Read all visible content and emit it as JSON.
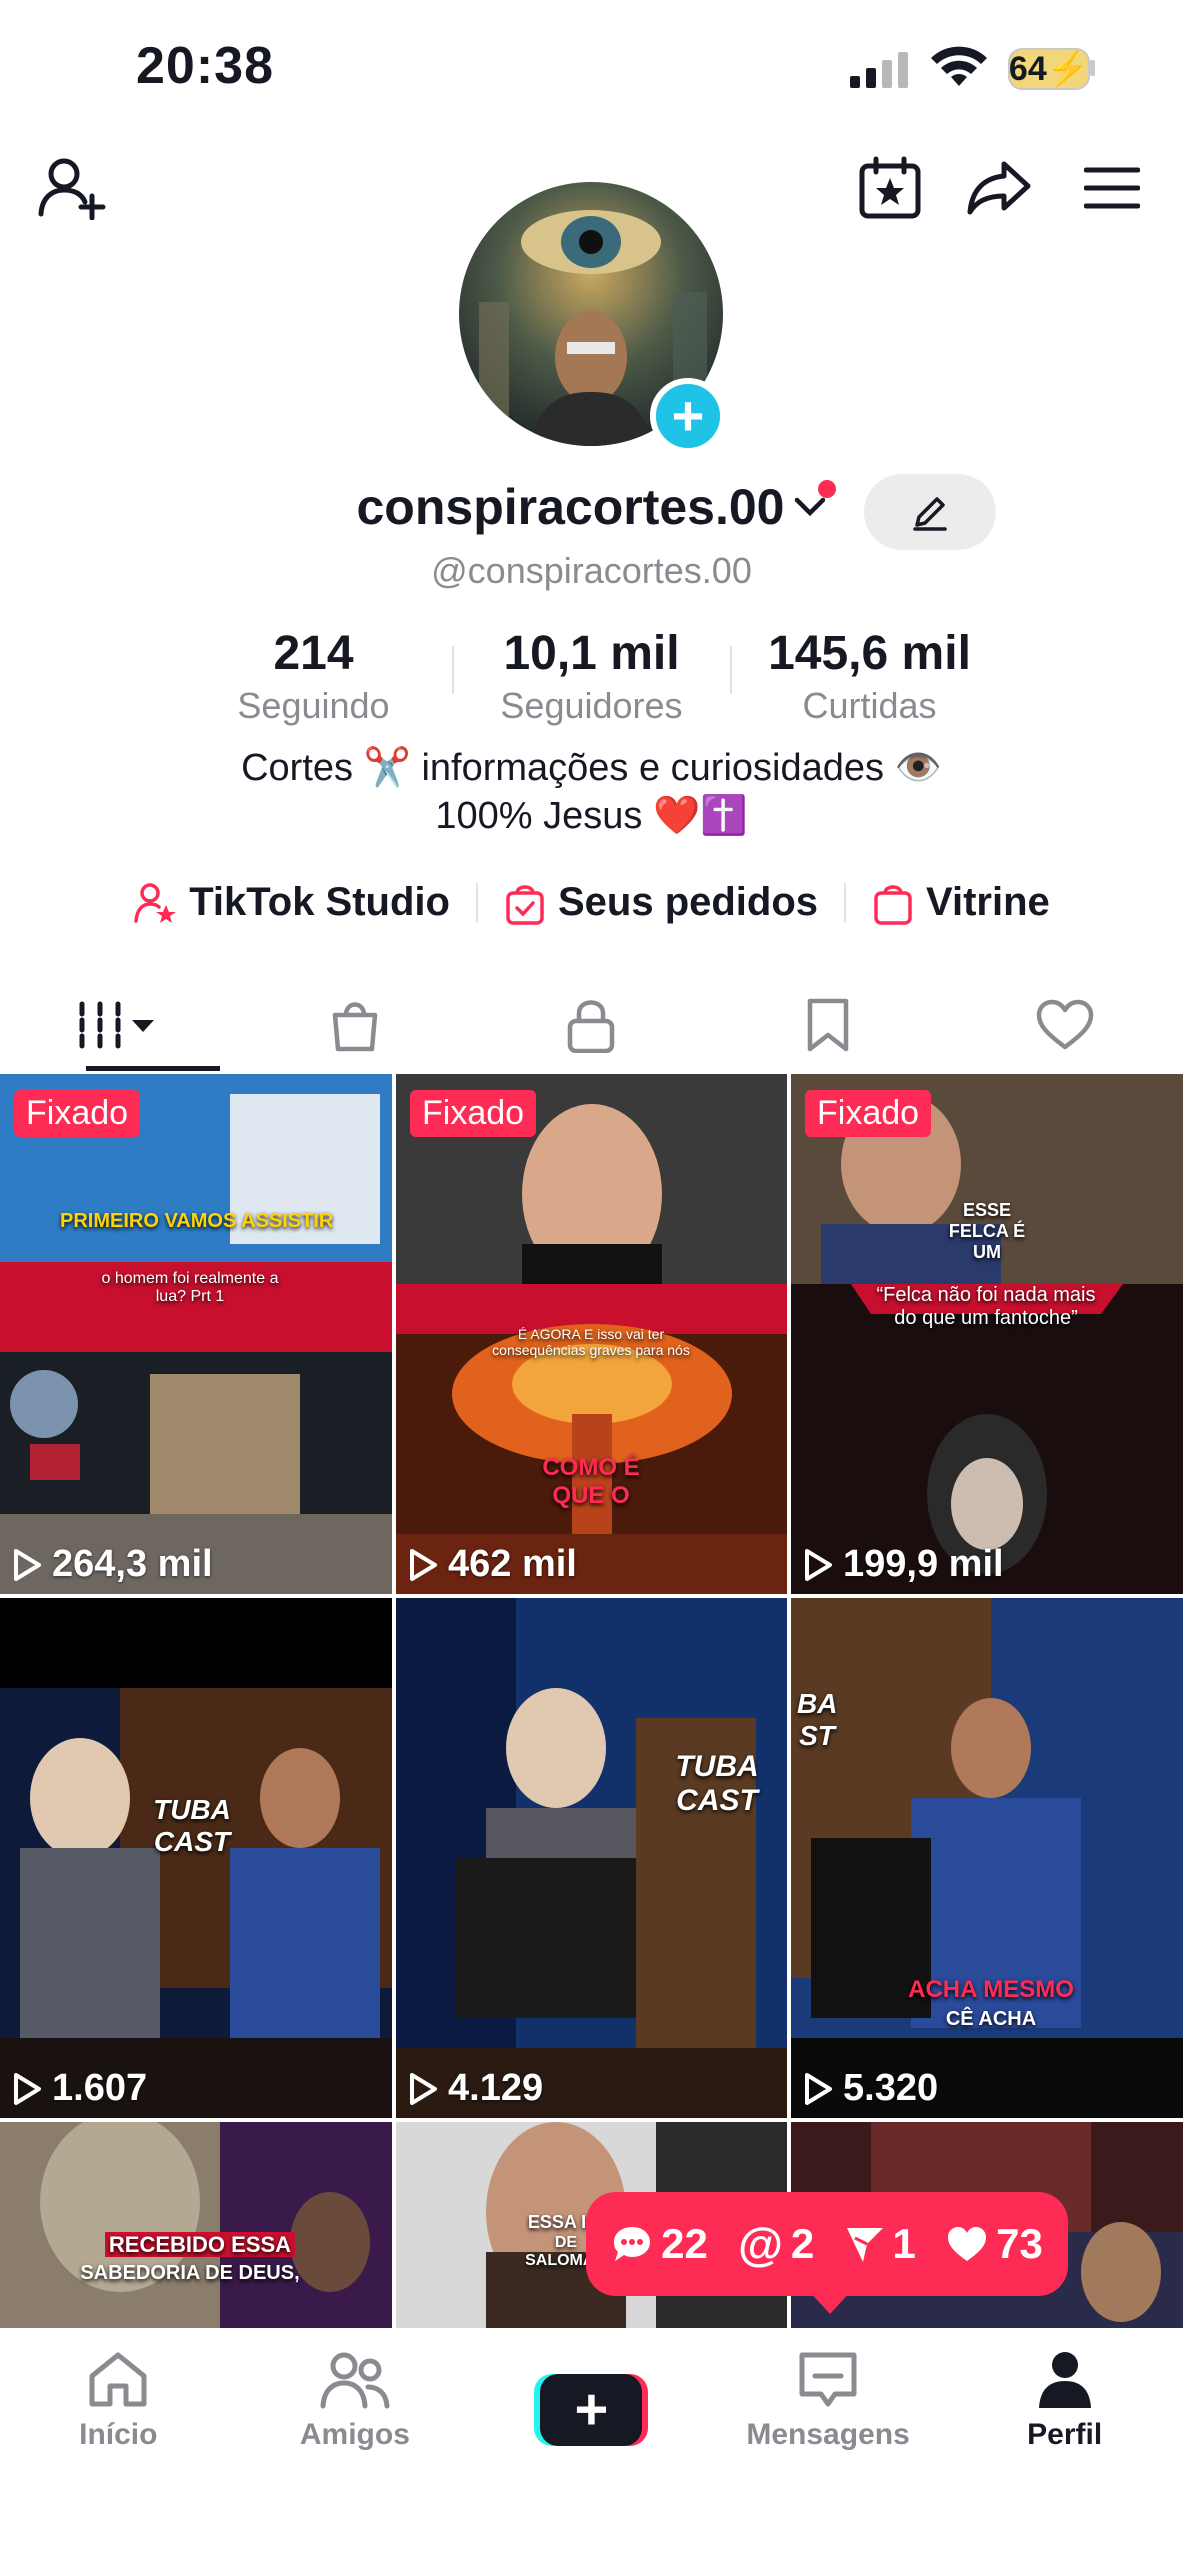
{
  "status_bar": {
    "time": "20:38",
    "battery": "64"
  },
  "profile": {
    "username": "conspiracortes.00",
    "handle": "@conspiracortes.00",
    "stats": [
      {
        "value": "214",
        "label": "Seguindo"
      },
      {
        "value": "10,1 mil",
        "label": "Seguidores"
      },
      {
        "value": "145,6 mil",
        "label": "Curtidas"
      }
    ],
    "bio_line1": "Cortes ✂️ informações e curiosidades 👁️",
    "bio_line2": "100% Jesus ❤️✝️"
  },
  "links": [
    {
      "label": "TikTok Studio",
      "icon": "person-star-icon"
    },
    {
      "label": "Seus pedidos",
      "icon": "shopping-bag-check-icon"
    },
    {
      "label": "Vitrine",
      "icon": "shopping-bag-icon"
    }
  ],
  "tabs": [
    "videos-grid-icon",
    "shop-bag-icon",
    "lock-icon",
    "bookmark-icon",
    "heart-icon"
  ],
  "videos": [
    {
      "pinned": "Fixado",
      "views": "264,3 mil",
      "caption_top": "PRIMEIRO VAMOS ASSISTIR",
      "caption_mid": "o homem foi realmente a lua? Prt 1"
    },
    {
      "pinned": "Fixado",
      "views": "462 mil",
      "caption_top": "É AGORA E isso vai ter consequências graves para nós",
      "caption_mid": "COMO É QUE O"
    },
    {
      "pinned": "Fixado",
      "views": "199,9 mil",
      "caption_top": "ESSE FELCA É UM",
      "caption_mid": "“Felca não foi nada mais do que um fantoche”"
    },
    {
      "pinned": "",
      "views": "1.607",
      "caption_top": "TUBA CAST",
      "caption_mid": ""
    },
    {
      "pinned": "",
      "views": "4.129",
      "caption_top": "TUBA CAST",
      "caption_mid": ""
    },
    {
      "pinned": "",
      "views": "5.320",
      "caption_top": "ACHA MESMO",
      "caption_mid": "CÊ ACHA"
    },
    {
      "pinned": "",
      "views": "",
      "caption_top": "RECEBIDO ESSA",
      "caption_mid": "SABEDORIA DE DEUS,"
    },
    {
      "pinned": "",
      "views": "",
      "caption_top": "ESSA INI",
      "caption_mid": "DE SALOMÃO"
    },
    {
      "pinned": "",
      "views": "",
      "caption_top": "",
      "caption_mid": ""
    }
  ],
  "notifications": {
    "comments": "22",
    "mentions": "2",
    "shares": "1",
    "likes": "73"
  },
  "bottom_nav": [
    {
      "label": "Início",
      "icon": "home-icon"
    },
    {
      "label": "Amigos",
      "icon": "friends-icon"
    },
    {
      "label": "",
      "icon": "create-plus-icon"
    },
    {
      "label": "Mensagens",
      "icon": "inbox-icon"
    },
    {
      "label": "Perfil",
      "icon": "profile-icon"
    }
  ],
  "colors": {
    "accent": "#fe2c55",
    "cyan": "#25f4ee",
    "text": "#161823",
    "secondary": "#8a8b91"
  }
}
